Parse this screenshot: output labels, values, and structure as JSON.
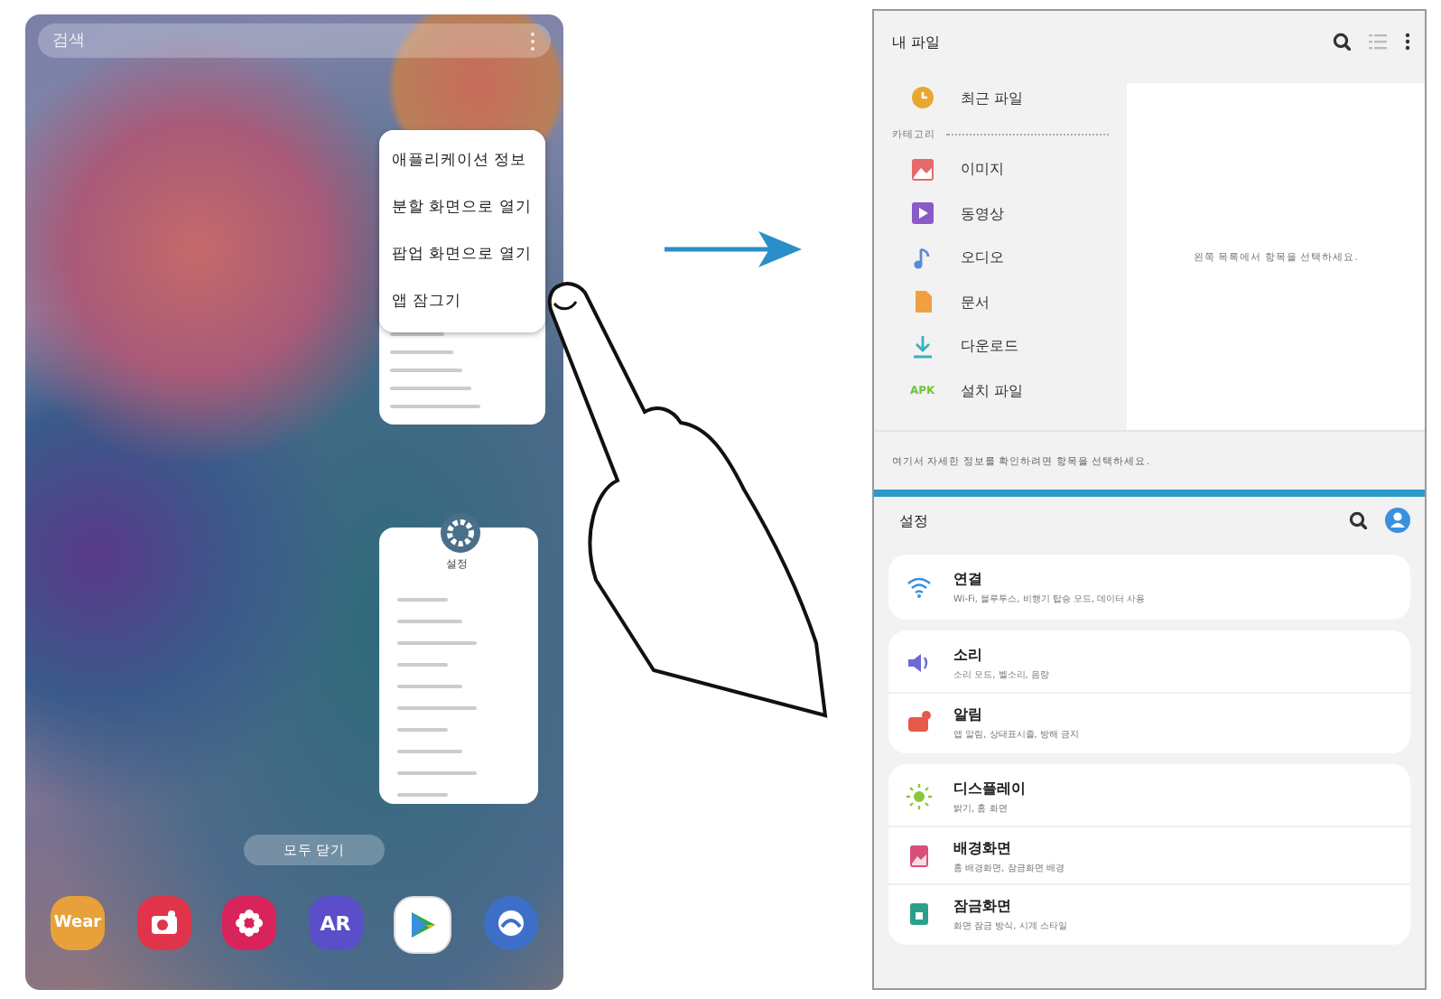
{
  "recents": {
    "search": {
      "placeholder": "검색"
    },
    "context_menu": [
      "애플리케이션 정보",
      "분할 화면으로 열기",
      "팝업 화면으로 열기",
      "앱 잠그기"
    ],
    "settings_card": {
      "label": "설정"
    },
    "close_all": "모두 닫기",
    "dock": [
      {
        "kind": "text",
        "label": "Wear",
        "color": "#e8a13a"
      },
      {
        "kind": "camera",
        "color": "#e0344a"
      },
      {
        "kind": "flower",
        "color": "#d8245a"
      },
      {
        "kind": "text",
        "label": "AR",
        "color": "#5a4fc8"
      },
      {
        "kind": "play",
        "color": "#ffffff"
      },
      {
        "kind": "wave",
        "color": "#3e6fc8"
      }
    ]
  },
  "files": {
    "title": "내 파일",
    "recent": {
      "kind": "clock",
      "label": "최근 파일"
    },
    "category_label": "카테고리",
    "categories": [
      {
        "kind": "image",
        "label": "이미지"
      },
      {
        "kind": "video",
        "label": "동영상"
      },
      {
        "kind": "audio",
        "label": "오디오"
      },
      {
        "kind": "doc",
        "label": "문서"
      },
      {
        "kind": "download",
        "label": "다운로드"
      },
      {
        "kind": "apk",
        "icon_text": "APK",
        "label": "설치 파일"
      }
    ],
    "empty_hint": "왼쪽 목록에서 항목을 선택하세요.",
    "footer_hint": "여기서 자세한 정보를 확인하려면 항목을 선택하세요."
  },
  "settings": {
    "title": "설정",
    "groups": [
      [
        {
          "kind": "wifi",
          "title": "연결",
          "subtitle": "Wi-Fi, 블루투스, 비행기 탑승 모드, 데이터 사용"
        }
      ],
      [
        {
          "kind": "sound",
          "title": "소리",
          "subtitle": "소리 모드, 벨소리, 음량"
        },
        {
          "kind": "notify",
          "title": "알림",
          "subtitle": "앱 알림, 상태표시줄, 방해 금지"
        }
      ],
      [
        {
          "kind": "display",
          "title": "디스플레이",
          "subtitle": "밝기, 홈 화면"
        },
        {
          "kind": "wallpaper",
          "title": "배경화면",
          "subtitle": "홈 배경화면, 잠금화면 배경"
        },
        {
          "kind": "lock",
          "title": "잠금화면",
          "subtitle": "화면 잠금 방식, 시계 스타일"
        }
      ]
    ]
  }
}
